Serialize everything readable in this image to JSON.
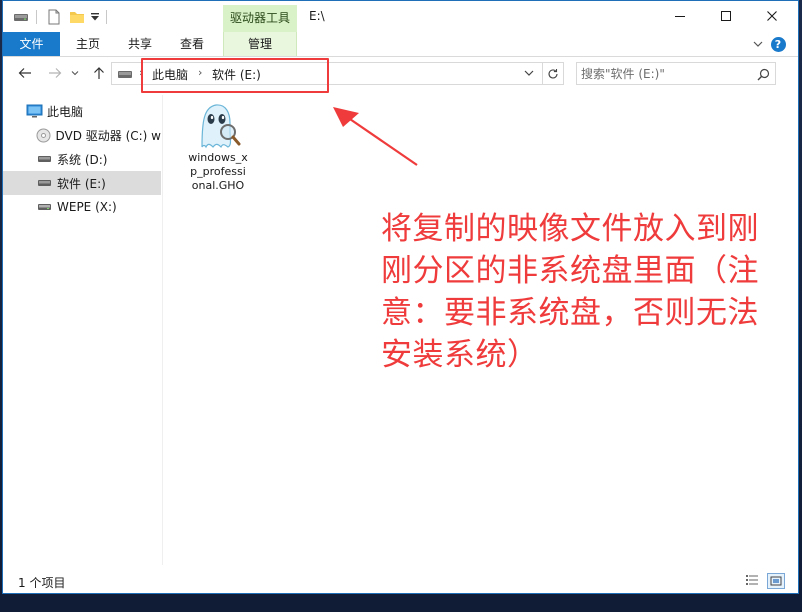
{
  "window": {
    "context_tab_header": "驱动器工具",
    "title": "E:\\"
  },
  "ribbon": {
    "file_tab": "文件",
    "tabs": [
      "主页",
      "共享",
      "查看",
      "管理"
    ]
  },
  "address_bar": {
    "crumbs": [
      "此电脑",
      "软件 (E:)"
    ]
  },
  "search": {
    "placeholder": "搜索\"软件 (E:)\""
  },
  "nav_pane": {
    "items": [
      {
        "label": "此电脑",
        "icon": "computer-icon"
      },
      {
        "label": "DVD 驱动器 (C:) w",
        "icon": "dvd-icon"
      },
      {
        "label": "系统 (D:)",
        "icon": "drive-icon"
      },
      {
        "label": "软件 (E:)",
        "icon": "drive-icon",
        "selected": true
      },
      {
        "label": "WEPE (X:)",
        "icon": "usb-drive-icon"
      }
    ]
  },
  "files": [
    {
      "name_lines": [
        "windows_x",
        "p_professi",
        "onal.GHO"
      ],
      "icon": "ghost-file-icon"
    }
  ],
  "annotation": {
    "text": "将复制的映像文件放入到刚刚分区的非系统盘里面（注意：要非系统盘，否则无法安装系统）",
    "color": "#ef3b3b"
  },
  "status_bar": {
    "text": "1 个项目"
  },
  "colors": {
    "accent": "#1979ca",
    "context_tab": "#d9f2c7",
    "selection": "#dcdcdc"
  }
}
